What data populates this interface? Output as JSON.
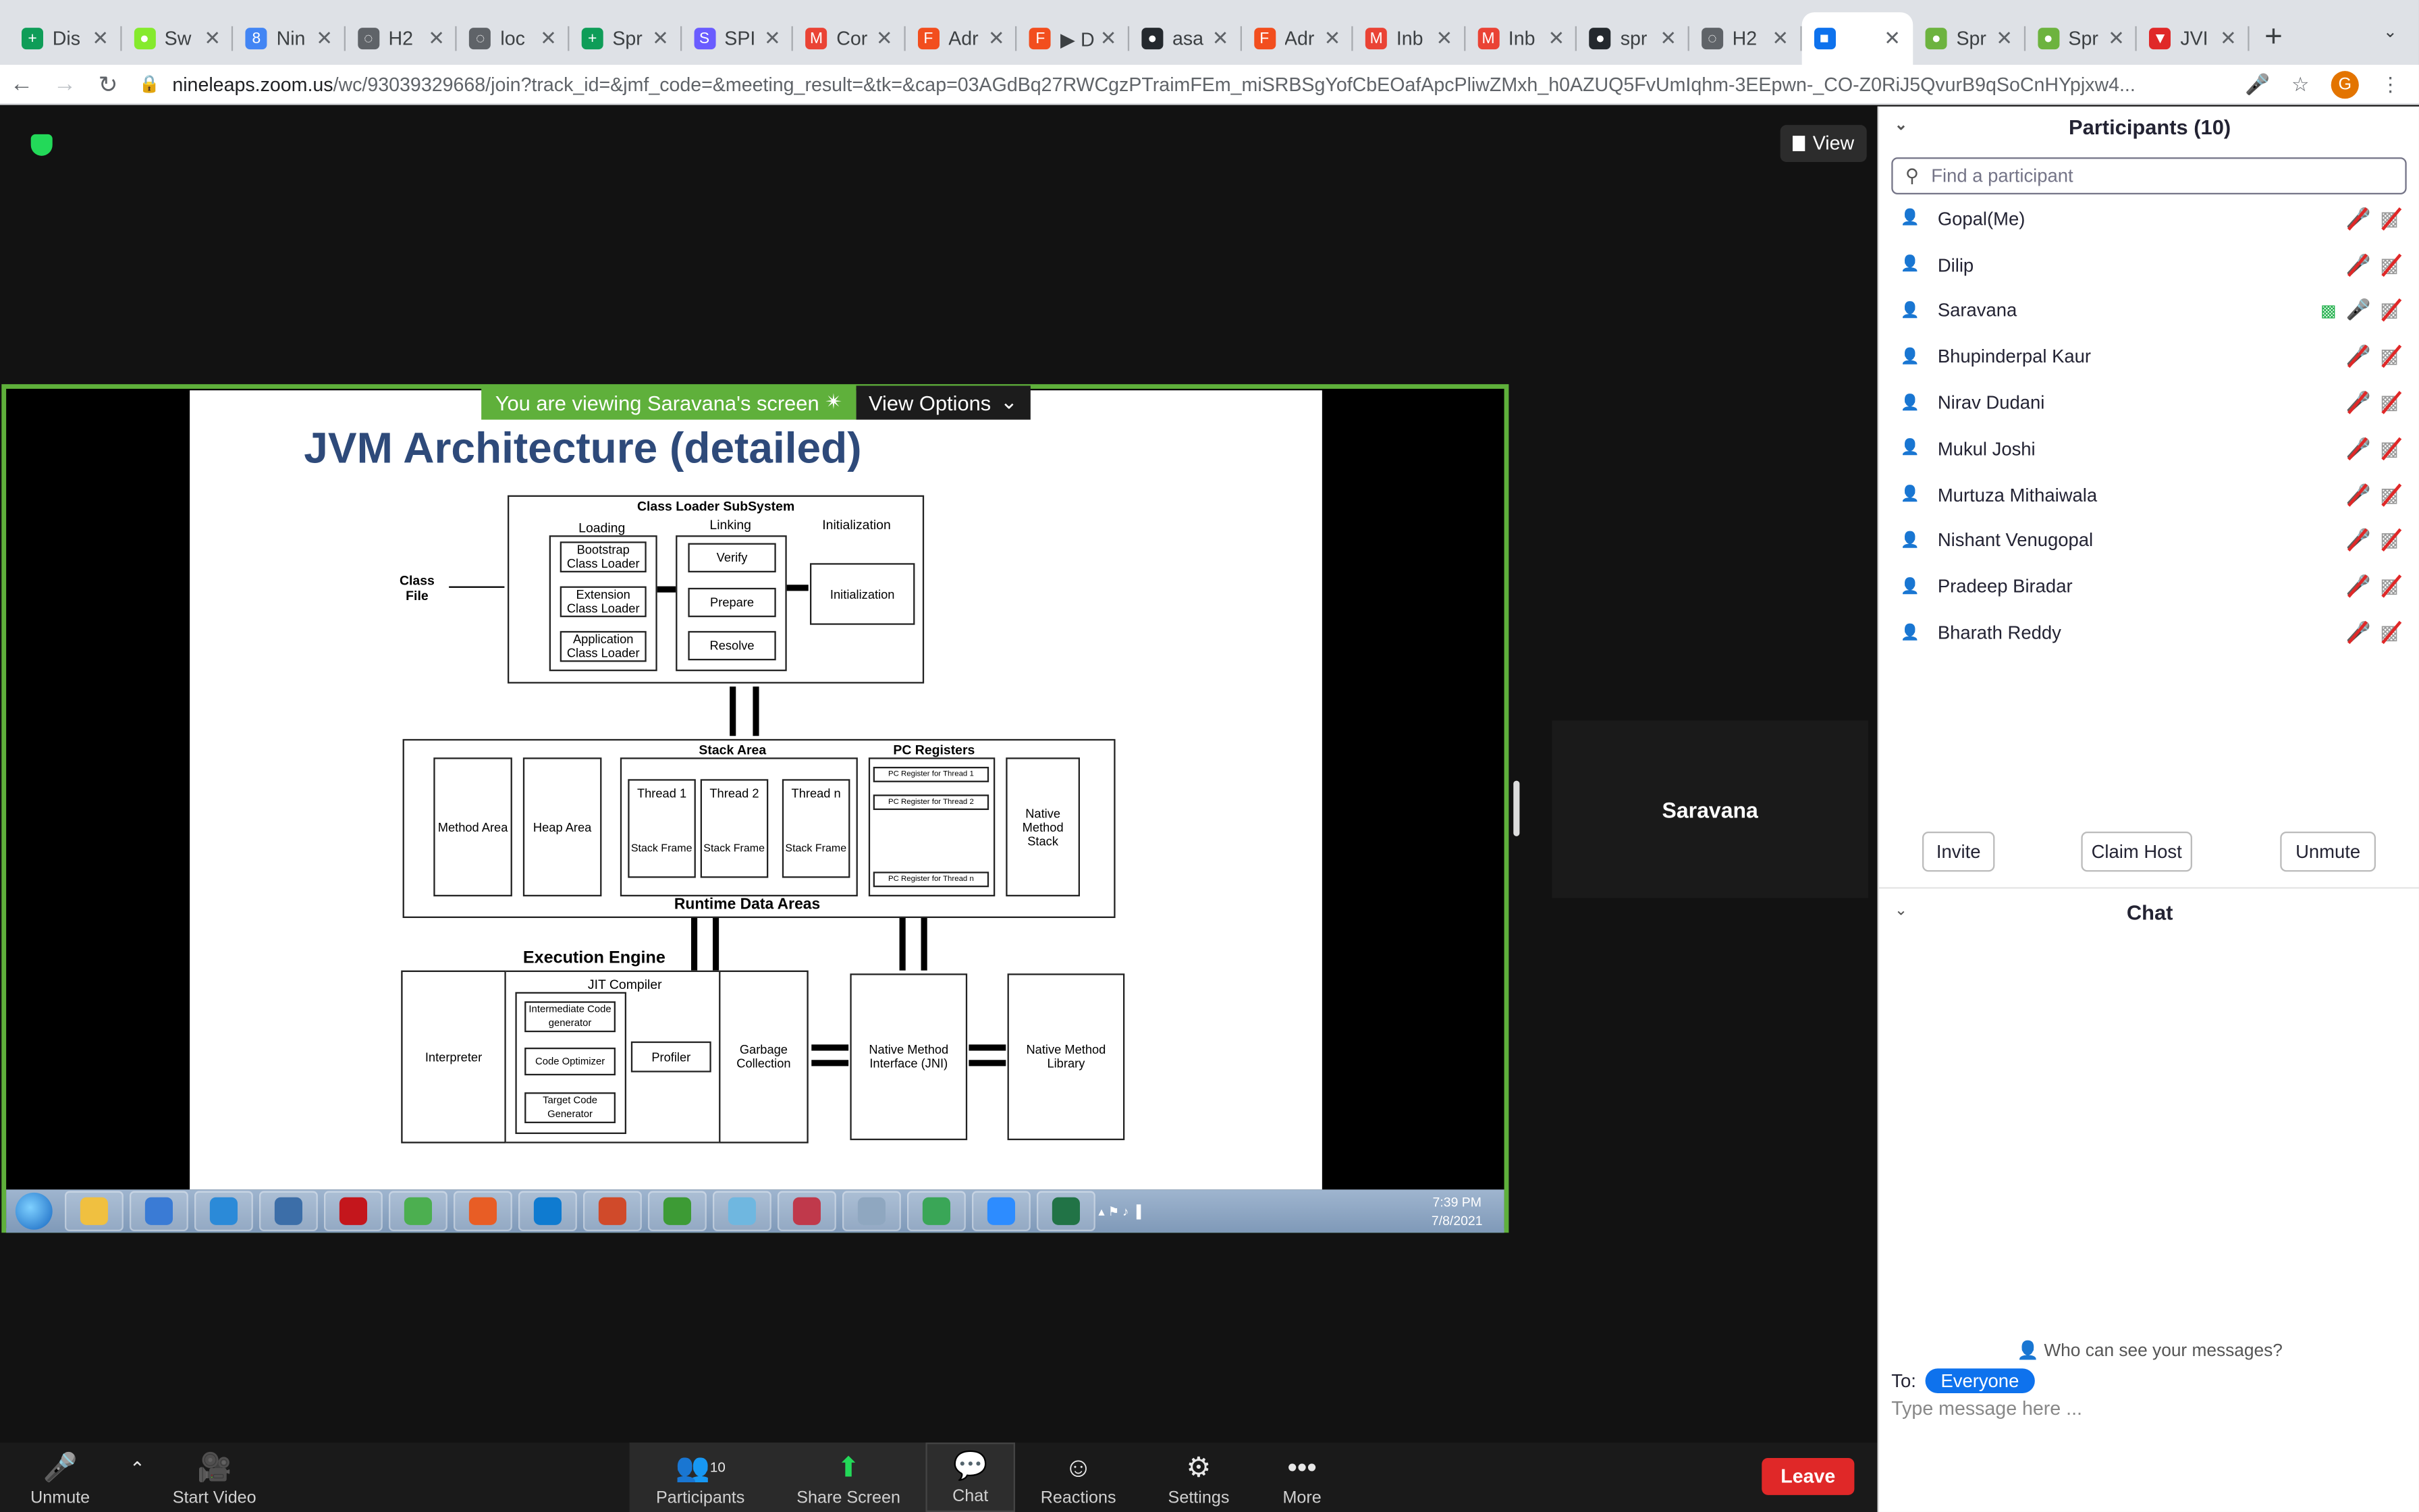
{
  "browser": {
    "tabs": [
      {
        "label": "Dis",
        "color": "#0f9d58",
        "glyph": "+"
      },
      {
        "label": "Sw",
        "color": "#85ea2d",
        "glyph": "●"
      },
      {
        "label": "Nin",
        "color": "#4285f4",
        "glyph": "8"
      },
      {
        "label": "H2",
        "color": "#5f6368",
        "glyph": "◌"
      },
      {
        "label": "loc",
        "color": "#5f6368",
        "glyph": "◌"
      },
      {
        "label": "Spr",
        "color": "#0f9d58",
        "glyph": "+"
      },
      {
        "label": "SPI",
        "color": "#6a5cff",
        "glyph": "S"
      },
      {
        "label": "Cor",
        "color": "#ea4335",
        "glyph": "M"
      },
      {
        "label": "Adr",
        "color": "#f24e1e",
        "glyph": "F"
      },
      {
        "label": "▶ D",
        "color": "#f24e1e",
        "glyph": "F"
      },
      {
        "label": "asa",
        "color": "#24292e",
        "glyph": "●"
      },
      {
        "label": "Adr",
        "color": "#f24e1e",
        "glyph": "F"
      },
      {
        "label": "Inb",
        "color": "#ea4335",
        "glyph": "M"
      },
      {
        "label": "Inb",
        "color": "#ea4335",
        "glyph": "M"
      },
      {
        "label": "spr",
        "color": "#24292e",
        "glyph": "●"
      },
      {
        "label": "H2",
        "color": "#5f6368",
        "glyph": "◌"
      },
      {
        "label": "",
        "color": "#0e72ed",
        "glyph": "■",
        "active": true
      },
      {
        "label": "Spr",
        "color": "#6db33f",
        "glyph": "●"
      },
      {
        "label": "Spr",
        "color": "#6db33f",
        "glyph": "●"
      },
      {
        "label": "JVI",
        "color": "#e02828",
        "glyph": "▼"
      }
    ],
    "url_host": "nineleaps.zoom.us",
    "url_path": "/wc/93039329668/join?track_id=&jmf_code=&meeting_result=&tk=&cap=03AGdBq27RWCgzPTraimFEm_miSRBSgYofCbEOafApcPliwZMxh_h0AZUQ5FvUmIqhm-3EEpwn-_CO-Z0RiJ5QvurB9qSoCnHYpjxw4...",
    "profile_initial": "G",
    "new_tab": "+",
    "tab_menu": "⌄"
  },
  "meeting": {
    "view_label": "View",
    "viewing_label": "You are viewing Saravana's screen",
    "view_options_label": "View Options",
    "speaker_name": "Saravana"
  },
  "slide": {
    "title": "JVM Architecture (detailed)",
    "class_file": "Class\nFile",
    "class_loader_subsystem": "Class Loader SubSystem",
    "loading": "Loading",
    "linking": "Linking",
    "initialization_header": "Initialization",
    "bootstrap": "Bootstrap Class Loader",
    "extension": "Extension Class Loader",
    "application": "Application Class Loader",
    "verify": "Verify",
    "prepare": "Prepare",
    "resolve": "Resolve",
    "initialization_box": "Initialization",
    "stack_area": "Stack Area",
    "pc_registers": "PC Registers",
    "method_area": "Method Area",
    "heap_area": "Heap Area",
    "thread1": "Thread 1",
    "thread2": "Thread 2",
    "threadn": "Thread n",
    "stack_frame": "Stack Frame",
    "pc_reg1": "PC Register for Thread 1",
    "pc_reg2": "PC Register for Thread 2",
    "pc_regn": "PC Register for Thread n",
    "native_method_stack": "Native Method Stack",
    "runtime_data_areas": "Runtime Data Areas",
    "execution_engine": "Execution Engine",
    "jit_compiler": "JIT Compiler",
    "interpreter": "Interpreter",
    "intermediate": "Intermediate Code generator",
    "code_optimizer": "Code Optimizer",
    "target_code": "Target Code Generator",
    "profiler": "Profiler",
    "garbage_collection": "Garbage Collection",
    "jni": "Native Method Interface (JNI)",
    "native_library": "Native Method Library"
  },
  "taskbar": {
    "time": "7:39 PM",
    "date": "7/8/2021",
    "app_colors": [
      "#f0c040",
      "#3a7bd5",
      "#2b8ad8",
      "#3c6ea8",
      "#c4161c",
      "#4caf50",
      "#e85d25",
      "#0f7bd0",
      "#d04a2a",
      "#3d9b35",
      "#6fb7e0",
      "#c0394b",
      "#8fa7c0",
      "#3aa657",
      "#2d8cff",
      "#217346"
    ]
  },
  "controls": {
    "unmute": "Unmute",
    "start_video": "Start Video",
    "participants": "Participants",
    "participant_count": "10",
    "share_screen": "Share Screen",
    "chat": "Chat",
    "reactions": "Reactions",
    "settings": "Settings",
    "more": "More",
    "leave": "Leave"
  },
  "participants_panel": {
    "title": "Participants (10)",
    "search_placeholder": "Find a participant",
    "people": [
      {
        "name": "Gopal(Me)",
        "mic": "off",
        "video": "off",
        "sharing": false
      },
      {
        "name": "Dilip",
        "mic": "off",
        "video": "off",
        "sharing": false
      },
      {
        "name": "Saravana",
        "mic": "on",
        "video": "off",
        "sharing": true
      },
      {
        "name": "Bhupinderpal Kaur",
        "mic": "off",
        "video": "off",
        "sharing": false
      },
      {
        "name": "Nirav Dudani",
        "mic": "off",
        "video": "off",
        "sharing": false
      },
      {
        "name": "Mukul Joshi",
        "mic": "off",
        "video": "off",
        "sharing": false
      },
      {
        "name": "Murtuza Mithaiwala",
        "mic": "off",
        "video": "off",
        "sharing": false
      },
      {
        "name": "Nishant Venugopal",
        "mic": "off",
        "video": "off",
        "sharing": false
      },
      {
        "name": "Pradeep Biradar",
        "mic": "off",
        "video": "off",
        "sharing": false
      },
      {
        "name": "Bharath Reddy",
        "mic": "off",
        "video": "off",
        "sharing": false
      }
    ],
    "invite": "Invite",
    "claim_host": "Claim Host",
    "unmute": "Unmute"
  },
  "chat_panel": {
    "title": "Chat",
    "who_can_see": "Who can see your messages?",
    "to_label": "To:",
    "recipient": "Everyone",
    "message_placeholder": "Type message here ..."
  }
}
